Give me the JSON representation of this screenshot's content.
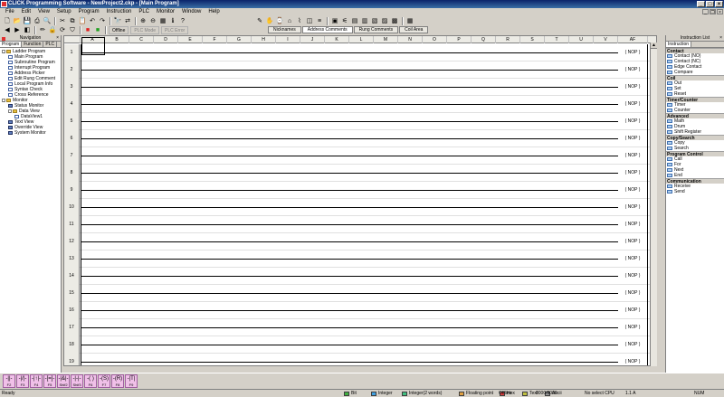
{
  "window": {
    "title": "CLICK Programming Software - NewProject2.ckp - [Main Program]"
  },
  "menu": [
    "File",
    "Edit",
    "View",
    "Setup",
    "Program",
    "Instruction",
    "PLC",
    "Monitor",
    "Window",
    "Help"
  ],
  "toolbar": {
    "mode_offline": "Offline",
    "mode_plc": "PLC Mode",
    "mode_error": "PLC Error",
    "view_tabs": [
      "Nicknames",
      "Address Comments",
      "Rung Comments",
      "Coil Area"
    ]
  },
  "navigation": {
    "title": "Navigation",
    "tabs": [
      "Program",
      "Function",
      "PLC"
    ],
    "tree": [
      {
        "label": "Ladder Program",
        "level": 0,
        "kind": "folder",
        "expander": "-"
      },
      {
        "label": "Main Program",
        "level": 1,
        "kind": "page"
      },
      {
        "label": "Subroutine Program",
        "level": 1,
        "kind": "page"
      },
      {
        "label": "Interrupt Program",
        "level": 1,
        "kind": "page"
      },
      {
        "label": "Address Picker",
        "level": 1,
        "kind": "page"
      },
      {
        "label": "Edit Rung Comment",
        "level": 1,
        "kind": "page"
      },
      {
        "label": "Local Program Info",
        "level": 1,
        "kind": "page"
      },
      {
        "label": "Syntax Check",
        "level": 1,
        "kind": "page"
      },
      {
        "label": "Cross Reference",
        "level": 1,
        "kind": "page"
      },
      {
        "label": "Monitor",
        "level": 0,
        "kind": "folder",
        "expander": "-"
      },
      {
        "label": "Status Monitor",
        "level": 1,
        "kind": "mon"
      },
      {
        "label": "Data View",
        "level": 1,
        "kind": "folder",
        "expander": "-"
      },
      {
        "label": "DataView1",
        "level": 2,
        "kind": "page"
      },
      {
        "label": "Text View",
        "level": 1,
        "kind": "mon"
      },
      {
        "label": "Override View",
        "level": 1,
        "kind": "mon"
      },
      {
        "label": "System Monitor",
        "level": 1,
        "kind": "mon"
      }
    ]
  },
  "ladder": {
    "columns": [
      "A",
      "B",
      "C",
      "D",
      "E",
      "F",
      "G",
      "H",
      "I",
      "J",
      "K",
      "L",
      "M",
      "N",
      "O",
      "P",
      "Q",
      "R",
      "S",
      "T",
      "U",
      "V"
    ],
    "output_column": "AF",
    "rungs": [
      {
        "num": "1",
        "out": "( NOP )"
      },
      {
        "num": "2",
        "out": "( NOP )"
      },
      {
        "num": "3",
        "out": "( NOP )"
      },
      {
        "num": "4",
        "out": "( NOP )"
      },
      {
        "num": "5",
        "out": "( NOP )"
      },
      {
        "num": "6",
        "out": "( NOP )"
      },
      {
        "num": "7",
        "out": "( NOP )"
      },
      {
        "num": "8",
        "out": "( NOP )"
      },
      {
        "num": "9",
        "out": "( NOP )"
      },
      {
        "num": "10",
        "out": "( NOP )"
      },
      {
        "num": "11",
        "out": "( NOP )"
      },
      {
        "num": "12",
        "out": "( NOP )"
      },
      {
        "num": "13",
        "out": "( NOP )"
      },
      {
        "num": "14",
        "out": "( NOP )"
      },
      {
        "num": "15",
        "out": "( NOP )"
      },
      {
        "num": "16",
        "out": "( NOP )"
      },
      {
        "num": "17",
        "out": "( NOP )"
      },
      {
        "num": "18",
        "out": "( NOP )"
      },
      {
        "num": "19",
        "out": "( NOP )"
      }
    ]
  },
  "instruction_list": {
    "title": "Instruction List",
    "tab": "Instruction",
    "categories": [
      {
        "name": "Contact",
        "items": [
          "Contact (NO)",
          "Contact (NC)",
          "Edge Contact",
          "Compare"
        ]
      },
      {
        "name": "Coil",
        "items": [
          "Out",
          "Set",
          "Reset"
        ]
      },
      {
        "name": "Timer/Counter",
        "items": [
          "Timer",
          "Counter"
        ]
      },
      {
        "name": "Advanced",
        "items": [
          "Math",
          "Drum",
          "Shift Register"
        ]
      },
      {
        "name": "Copy/Search",
        "items": [
          "Copy",
          "Search"
        ]
      },
      {
        "name": "Program Control",
        "items": [
          "Call",
          "For",
          "Next",
          "End"
        ]
      },
      {
        "name": "Communication",
        "items": [
          "Receive",
          "Send"
        ]
      }
    ]
  },
  "function_keys": [
    {
      "label": "F2",
      "sym": "-||-"
    },
    {
      "label": "F3",
      "sym": "-|/|-"
    },
    {
      "label": "F4",
      "sym": "-|↑|-"
    },
    {
      "label": "F5",
      "sym": "-[=]-"
    },
    {
      "label": "Shif2",
      "sym": "-|&|-"
    },
    {
      "label": "Shif3",
      "sym": "-|-|-"
    },
    {
      "label": "F6",
      "sym": "-( )"
    },
    {
      "label": "F7",
      "sym": "-(S)"
    },
    {
      "label": "F8",
      "sym": "-(R)"
    },
    {
      "label": "F9",
      "sym": "-|T|"
    }
  ],
  "statusbar": {
    "ready": "Ready",
    "legend": [
      {
        "label": "Bit",
        "color": "#40b040"
      },
      {
        "label": "Integer",
        "color": "#40a0e0"
      },
      {
        "label": "Integer(2 words)",
        "color": "#40c080"
      },
      {
        "label": "Floating point",
        "color": "#e0a040"
      },
      {
        "label": "Hex",
        "color": "#e04040"
      },
      {
        "label": "Text",
        "color": "#c0c040"
      },
      {
        "label": "Ascii",
        "color": "#a0a0a0"
      }
    ],
    "offline": "Offline",
    "steps": "0000/8000",
    "cpu": "No select CPU",
    "version": "1.1 A",
    "num": "NUM"
  }
}
